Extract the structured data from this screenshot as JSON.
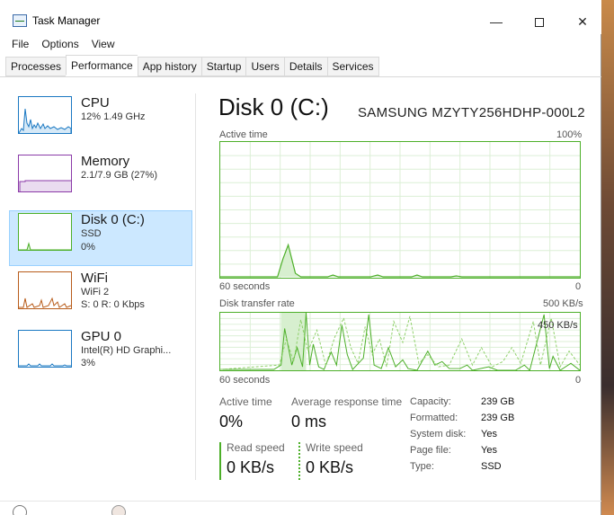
{
  "window": {
    "title": "Task Manager"
  },
  "menu": [
    "File",
    "Options",
    "View"
  ],
  "tabs": [
    {
      "label": "Processes",
      "active": false
    },
    {
      "label": "Performance",
      "active": true
    },
    {
      "label": "App history",
      "active": false
    },
    {
      "label": "Startup",
      "active": false
    },
    {
      "label": "Users",
      "active": false
    },
    {
      "label": "Details",
      "active": false
    },
    {
      "label": "Services",
      "active": false
    }
  ],
  "sidebar": [
    {
      "name": "CPU",
      "lines": [
        "12%  1.49 GHz"
      ],
      "color": "#1a78c2"
    },
    {
      "name": "Memory",
      "lines": [
        "2.1/7.9 GB (27%)"
      ],
      "color": "#8b3aa8"
    },
    {
      "name": "Disk 0 (C:)",
      "lines": [
        "SSD",
        "0%"
      ],
      "color": "#4caf28",
      "selected": true
    },
    {
      "name": "WiFi",
      "lines": [
        "WiFi 2",
        "S: 0 R: 0 Kbps"
      ],
      "color": "#b85c1a"
    },
    {
      "name": "GPU 0",
      "lines": [
        "Intel(R) HD Graphi...",
        "3%"
      ],
      "color": "#1a78c2"
    }
  ],
  "main": {
    "title": "Disk 0 (C:)",
    "model": "SAMSUNG MZYTY256HDHP-000L2",
    "active_time_graph": {
      "label": "Active time",
      "max_label": "100%",
      "time_label": "60 seconds",
      "min_label": "0"
    },
    "transfer_graph": {
      "label": "Disk transfer rate",
      "max_label": "500 KB/s",
      "mid_label": "450 KB/s",
      "time_label": "60 seconds",
      "min_label": "0"
    },
    "stats": {
      "active_time_label": "Active time",
      "active_time_value": "0%",
      "response_label": "Average response time",
      "response_value": "0 ms",
      "read_label": "Read speed",
      "read_value": "0 KB/s",
      "write_label": "Write speed",
      "write_value": "0 KB/s"
    },
    "details": [
      {
        "key": "Capacity:",
        "value": "239 GB"
      },
      {
        "key": "Formatted:",
        "value": "239 GB"
      },
      {
        "key": "System disk:",
        "value": "Yes"
      },
      {
        "key": "Page file:",
        "value": "Yes"
      },
      {
        "key": "Type:",
        "value": "SSD"
      }
    ]
  },
  "colors": {
    "disk": "#4caf28",
    "grid": "#dcefd6"
  }
}
